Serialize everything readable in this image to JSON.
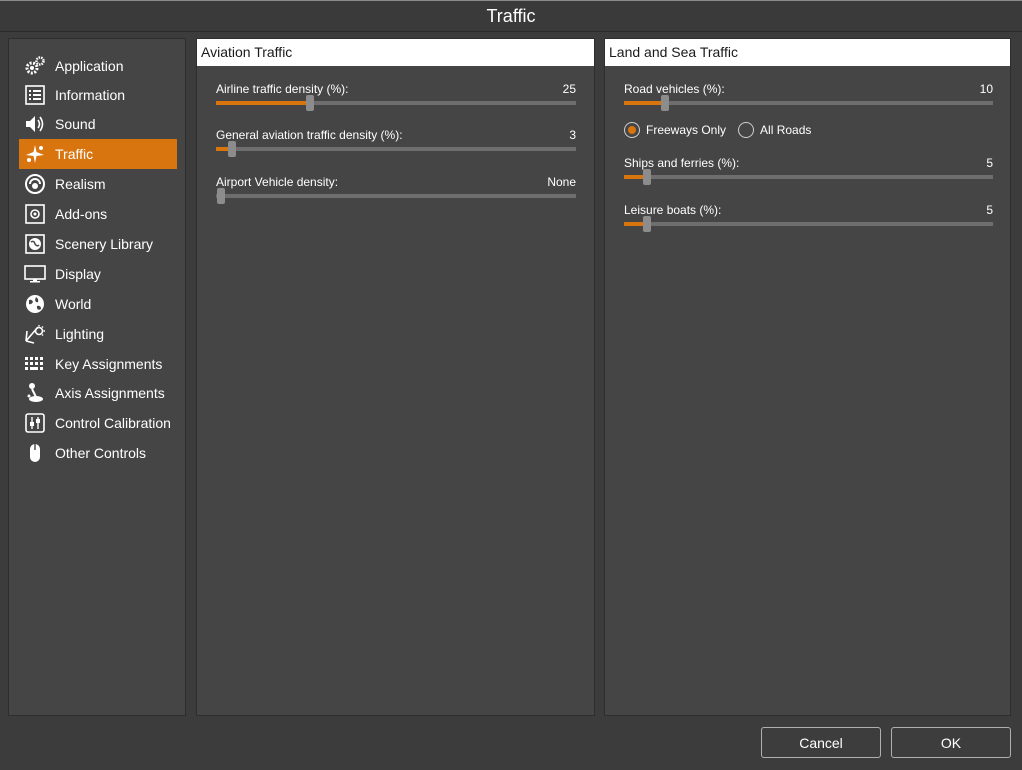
{
  "window": {
    "title": "Traffic"
  },
  "sidebar": {
    "items": [
      {
        "label": "Application",
        "icon": "gears-icon"
      },
      {
        "label": "Information",
        "icon": "list-icon"
      },
      {
        "label": "Sound",
        "icon": "speaker-icon"
      },
      {
        "label": "Traffic",
        "icon": "traffic-icon",
        "active": true
      },
      {
        "label": "Realism",
        "icon": "realism-icon"
      },
      {
        "label": "Add-ons",
        "icon": "addons-icon"
      },
      {
        "label": "Scenery Library",
        "icon": "scenery-icon"
      },
      {
        "label": "Display",
        "icon": "monitor-icon"
      },
      {
        "label": "World",
        "icon": "globe-icon"
      },
      {
        "label": "Lighting",
        "icon": "lighting-icon"
      },
      {
        "label": "Key Assignments",
        "icon": "keyboard-icon"
      },
      {
        "label": "Axis Assignments",
        "icon": "joystick-icon"
      },
      {
        "label": "Control Calibration",
        "icon": "sliders-icon"
      },
      {
        "label": "Other Controls",
        "icon": "mouse-icon"
      }
    ]
  },
  "aviation": {
    "header": "Aviation Traffic",
    "airline": {
      "label": "Airline traffic density (%):",
      "value": "25",
      "level": 0.25
    },
    "general": {
      "label": "General aviation traffic density (%):",
      "value": "3",
      "level": 0.03
    },
    "airport": {
      "label": "Airport Vehicle density:",
      "value": "None",
      "level": 0.0
    }
  },
  "land_sea": {
    "header": "Land and Sea Traffic",
    "road": {
      "label": "Road vehicles (%):",
      "value": "10",
      "level": 0.1
    },
    "road_mode": {
      "options": [
        "Freeways Only",
        "All Roads"
      ],
      "selected": "Freeways Only"
    },
    "ships": {
      "label": "Ships and ferries (%):",
      "value": "5",
      "level": 0.05
    },
    "leisure": {
      "label": "Leisure boats (%):",
      "value": "5",
      "level": 0.05
    }
  },
  "buttons": {
    "cancel": "Cancel",
    "ok": "OK"
  },
  "colors": {
    "accent": "#d8750f",
    "background": "#3c3c3c",
    "panel": "#454545"
  }
}
